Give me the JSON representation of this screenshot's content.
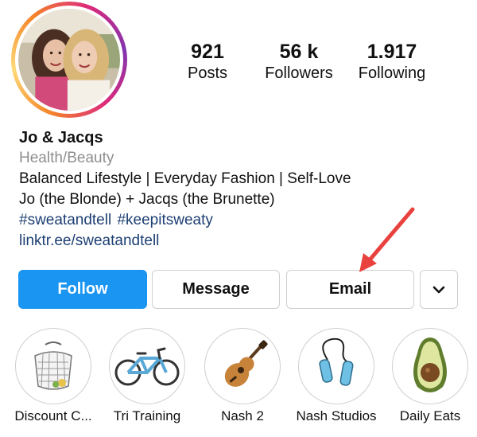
{
  "profile": {
    "stats": [
      {
        "number": "921",
        "label": "Posts"
      },
      {
        "number": "56 k",
        "label": "Followers"
      },
      {
        "number": "1.917",
        "label": "Following"
      }
    ],
    "name": "Jo & Jacqs",
    "category": "Health/Beauty",
    "bio_lines": [
      "Balanced Lifestyle | Everyday Fashion | Self-Love",
      "Jo (the Blonde) + Jacqs (the Brunette)"
    ],
    "hashtags": [
      "#sweatandtell",
      "#keepitsweaty"
    ],
    "link": "linktr.ee/sweatandtell"
  },
  "actions": {
    "follow": "Follow",
    "message": "Message",
    "email": "Email",
    "more_icon": "chevron-down-icon"
  },
  "highlights": [
    {
      "label": "Discount C...",
      "icon": "mesh-bag-icon"
    },
    {
      "label": "Tri Training",
      "icon": "bicycle-icon"
    },
    {
      "label": "Nash 2",
      "icon": "guitar-icon"
    },
    {
      "label": "Nash Studios",
      "icon": "jump-rope-icon"
    },
    {
      "label": "Daily Eats",
      "icon": "avocado-icon"
    }
  ],
  "colors": {
    "follow_button": "#1a95f2",
    "link_text": "#1d3f73",
    "arrow": "#e8413e"
  }
}
